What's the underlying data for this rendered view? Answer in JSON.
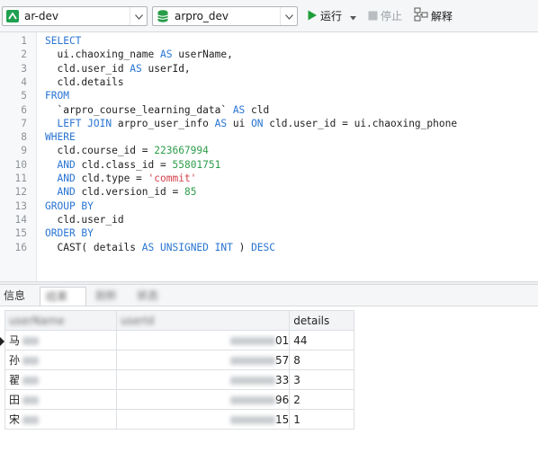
{
  "toolbar": {
    "connection": "ar-dev",
    "database": "arpro_dev",
    "run_label": "运行",
    "stop_label": "停止",
    "explain_label": "解释",
    "colors": {
      "run_green": "#1f9d3a",
      "db_green": "#2a9d4a",
      "accent_blue": "#2874d2"
    }
  },
  "editor": {
    "lines": [
      {
        "n": "1",
        "t": [
          {
            "c": "kw",
            "v": "SELECT"
          }
        ]
      },
      {
        "n": "2",
        "t": [
          {
            "c": "",
            "v": "  ui.chaoxing_name "
          },
          {
            "c": "kw",
            "v": "AS"
          },
          {
            "c": "",
            "v": " userName,"
          }
        ]
      },
      {
        "n": "3",
        "t": [
          {
            "c": "",
            "v": "  cld.user_id "
          },
          {
            "c": "kw",
            "v": "AS"
          },
          {
            "c": "",
            "v": " userId,"
          }
        ]
      },
      {
        "n": "4",
        "t": [
          {
            "c": "",
            "v": "  cld.details"
          }
        ]
      },
      {
        "n": "5",
        "t": [
          {
            "c": "kw",
            "v": "FROM"
          }
        ]
      },
      {
        "n": "6",
        "t": [
          {
            "c": "",
            "v": "  `arpro_course_learning_data` "
          },
          {
            "c": "kw",
            "v": "AS"
          },
          {
            "c": "",
            "v": " cld"
          }
        ]
      },
      {
        "n": "7",
        "t": [
          {
            "c": "",
            "v": "  "
          },
          {
            "c": "kw",
            "v": "LEFT JOIN"
          },
          {
            "c": "",
            "v": " arpro_user_info "
          },
          {
            "c": "kw",
            "v": "AS"
          },
          {
            "c": "",
            "v": " ui "
          },
          {
            "c": "kw",
            "v": "ON"
          },
          {
            "c": "",
            "v": " cld.user_id = ui.chaoxing_phone"
          }
        ]
      },
      {
        "n": "8",
        "t": [
          {
            "c": "kw",
            "v": "WHERE"
          }
        ]
      },
      {
        "n": "9",
        "t": [
          {
            "c": "",
            "v": "  cld.course_id = "
          },
          {
            "c": "num",
            "v": "223667994"
          }
        ]
      },
      {
        "n": "10",
        "t": [
          {
            "c": "",
            "v": "  "
          },
          {
            "c": "kw",
            "v": "AND"
          },
          {
            "c": "",
            "v": " cld.class_id = "
          },
          {
            "c": "num",
            "v": "55801751"
          }
        ]
      },
      {
        "n": "11",
        "t": [
          {
            "c": "",
            "v": "  "
          },
          {
            "c": "kw",
            "v": "AND"
          },
          {
            "c": "",
            "v": " cld.type = "
          },
          {
            "c": "str",
            "v": "'commit'"
          }
        ]
      },
      {
        "n": "12",
        "t": [
          {
            "c": "",
            "v": "  "
          },
          {
            "c": "kw",
            "v": "AND"
          },
          {
            "c": "",
            "v": " cld.version_id = "
          },
          {
            "c": "num",
            "v": "85"
          }
        ]
      },
      {
        "n": "13",
        "t": [
          {
            "c": "kw",
            "v": "GROUP BY"
          }
        ]
      },
      {
        "n": "14",
        "t": [
          {
            "c": "",
            "v": "  cld.user_id"
          }
        ]
      },
      {
        "n": "15",
        "t": [
          {
            "c": "kw",
            "v": "ORDER BY"
          }
        ]
      },
      {
        "n": "16",
        "t": [
          {
            "c": "",
            "v": "  CAST( details "
          },
          {
            "c": "kw",
            "v": "AS"
          },
          {
            "c": "",
            "v": " "
          },
          {
            "c": "kw",
            "v": "UNSIGNED INT"
          },
          {
            "c": "",
            "v": " ) "
          },
          {
            "c": "kw",
            "v": "DESC"
          }
        ]
      }
    ]
  },
  "results": {
    "tabs": [
      "信息",
      "结果",
      "剖析",
      "状态"
    ],
    "columns": [
      "userName",
      "userId",
      "details"
    ],
    "rows": [
      {
        "name_visible": "马",
        "id_visible": "01",
        "details": "44"
      },
      {
        "name_visible": "孙",
        "id_visible": "57",
        "details": "8"
      },
      {
        "name_visible": "翟",
        "id_visible": "33",
        "details": "3"
      },
      {
        "name_visible": "田",
        "id_visible": "96",
        "details": "2"
      },
      {
        "name_visible": "宋",
        "id_visible": "15",
        "details": "1"
      }
    ]
  }
}
